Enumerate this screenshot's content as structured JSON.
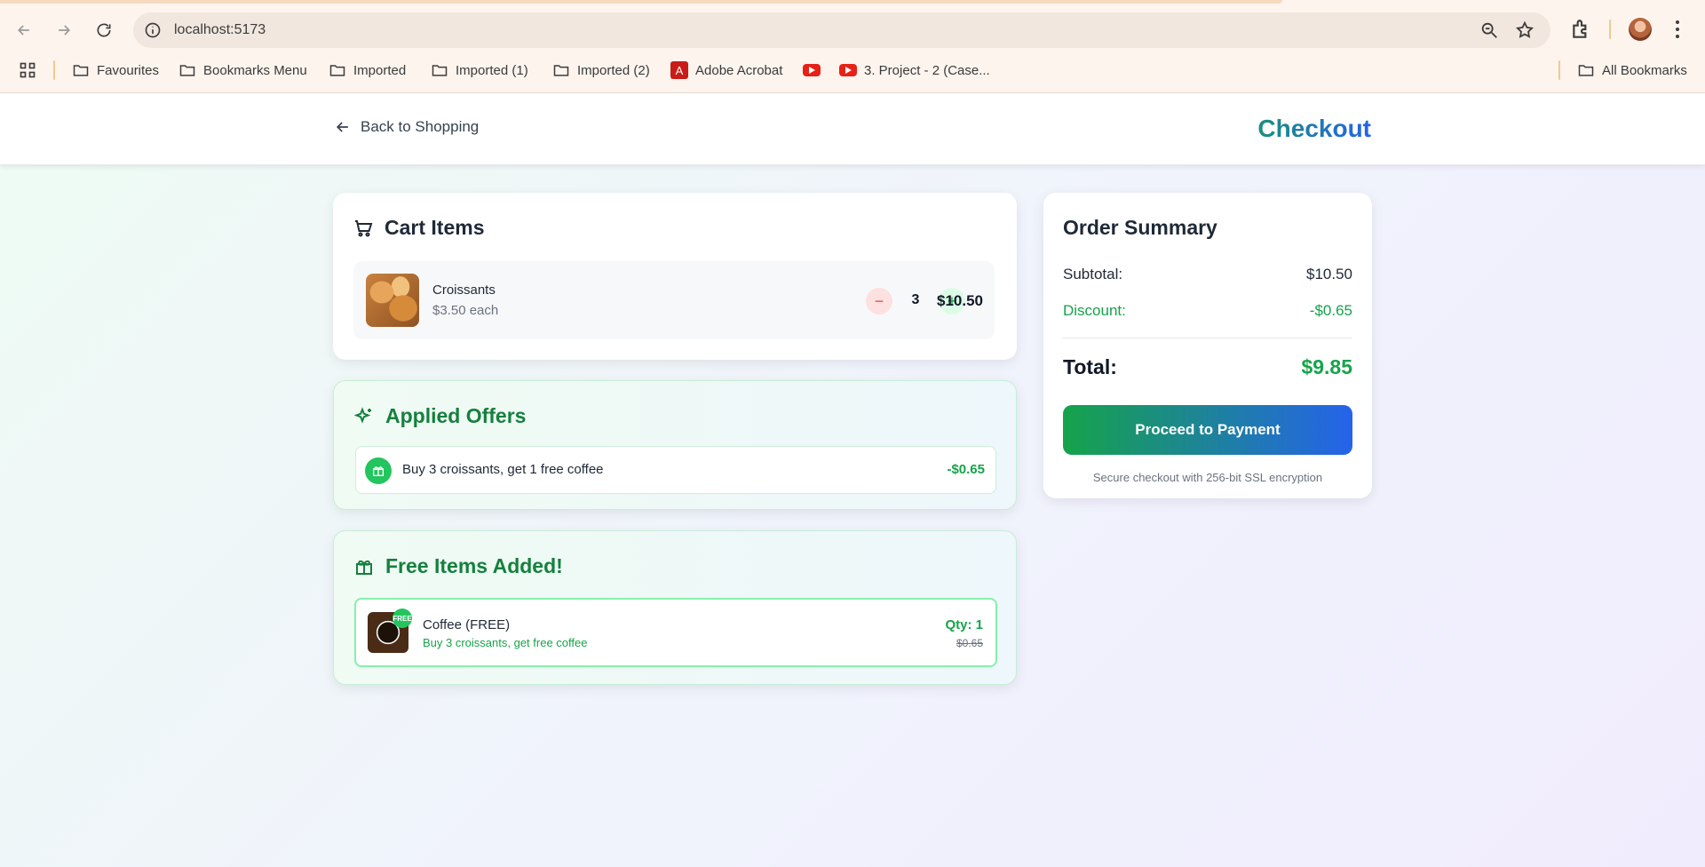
{
  "browser": {
    "url": "localhost:5173",
    "bookmarks": [
      {
        "label": "Favourites",
        "icon": "folder-icon"
      },
      {
        "label": "Bookmarks Menu",
        "icon": "folder-icon"
      },
      {
        "label": "Imported",
        "icon": "folder-icon"
      },
      {
        "label": "Imported (1)",
        "icon": "folder-icon"
      },
      {
        "label": "Imported (2)",
        "icon": "folder-icon"
      },
      {
        "label": "Adobe Acrobat",
        "icon": "acrobat-icon"
      },
      {
        "label": "",
        "icon": "youtube-icon"
      },
      {
        "label": "3. Project - 2 (Case...",
        "icon": "youtube-icon"
      }
    ],
    "all_bookmarks": "All Bookmarks"
  },
  "header": {
    "back_label": "Back to Shopping",
    "title": "Checkout"
  },
  "cart": {
    "title": "Cart Items",
    "items": [
      {
        "name": "Croissants",
        "unit_price": "$3.50 each",
        "quantity": "3",
        "line_total": "$10.50",
        "minus": "−",
        "plus": "+"
      }
    ]
  },
  "offers": {
    "title": "Applied Offers",
    "items": [
      {
        "text": "Buy 3 croissants, get 1 free coffee",
        "amount": "-$0.65"
      }
    ]
  },
  "free_items": {
    "title": "Free Items Added!",
    "items": [
      {
        "tag": "FREE",
        "name": "Coffee (FREE)",
        "desc": "Buy 3 croissants, get free coffee",
        "qty": "Qty: 1",
        "old_price": "$0.65"
      }
    ]
  },
  "summary": {
    "title": "Order Summary",
    "subtotal_label": "Subtotal:",
    "subtotal_value": "$10.50",
    "discount_label": "Discount:",
    "discount_value": "-$0.65",
    "total_label": "Total:",
    "total_value": "$9.85",
    "pay_label": "Proceed to Payment",
    "secure_note": "Secure checkout with 256-bit SSL encryption"
  },
  "colors": {
    "accent_green": "#16a34a",
    "accent_blue": "#2563eb",
    "danger": "#ef4444"
  }
}
